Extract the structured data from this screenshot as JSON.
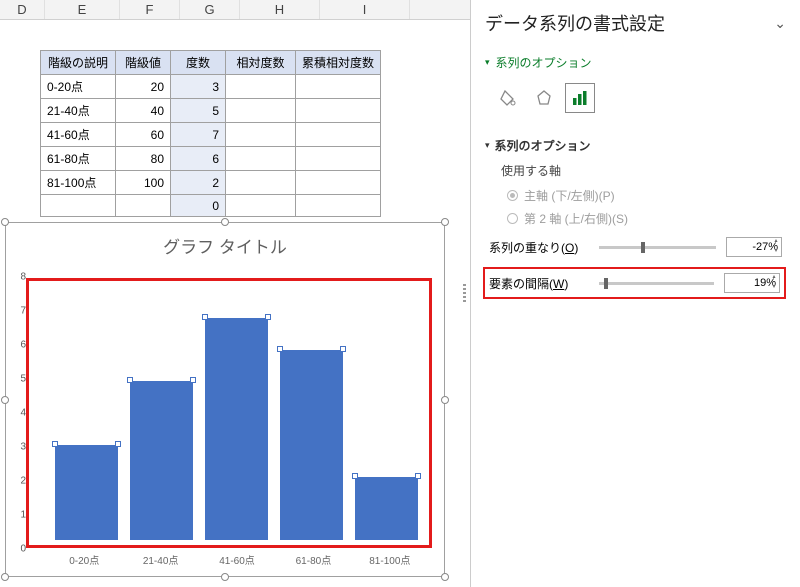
{
  "columns": [
    "D",
    "E",
    "F",
    "G",
    "H",
    "I"
  ],
  "table": {
    "headers": {
      "c1": "階級の説明",
      "c2": "階級値",
      "c3": "度数",
      "c4": "相対度数",
      "c5": "累積相対度数"
    },
    "rows": [
      {
        "c1": "0-20点",
        "c2": "20",
        "c3": "3"
      },
      {
        "c1": "21-40点",
        "c2": "40",
        "c3": "5"
      },
      {
        "c1": "41-60点",
        "c2": "60",
        "c3": "7"
      },
      {
        "c1": "61-80点",
        "c2": "80",
        "c3": "6"
      },
      {
        "c1": "81-100点",
        "c2": "100",
        "c3": "2"
      },
      {
        "c1": "",
        "c2": "",
        "c3": "0"
      }
    ]
  },
  "chart": {
    "title": "グラフ タイトル"
  },
  "chart_data": {
    "type": "bar",
    "categories": [
      "0-20点",
      "21-40点",
      "41-60点",
      "61-80点",
      "81-100点"
    ],
    "values": [
      3,
      5,
      7,
      6,
      2
    ],
    "title": "グラフ タイトル",
    "xlabel": "",
    "ylabel": "",
    "ylim": [
      0,
      8
    ],
    "yticks": [
      0,
      1,
      2,
      3,
      4,
      5,
      6,
      7,
      8
    ]
  },
  "pane": {
    "title": "データ系列の書式設定",
    "section": "系列のオプション",
    "subsection": "系列のオプション",
    "axis_label": "使用する軸",
    "axis_primary": "主軸 (下/左側)(P)",
    "axis_secondary": "第 2 軸 (上/右側)(S)",
    "overlap_label_pre": "系列の重なり(",
    "overlap_label_u": "O",
    "overlap_label_post": ")",
    "overlap_value": "-27%",
    "gap_label_pre": "要素の間隔(",
    "gap_label_u": "W",
    "gap_label_post": ")",
    "gap_value": "19%"
  }
}
